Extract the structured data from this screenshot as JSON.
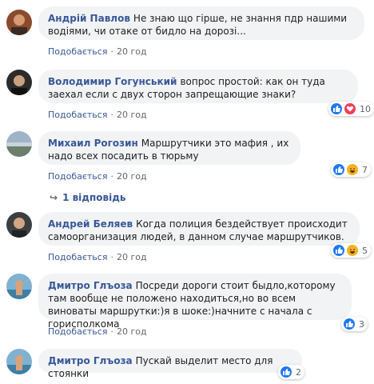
{
  "like_label": "Подобається",
  "comments": [
    {
      "author": "Андрій Павлов",
      "text": "Не знаю що гірше, не знання пдр нашими водіями, чи отаке от бидло на дорозі...",
      "time": "20 год",
      "reactions": [],
      "count": ""
    },
    {
      "author": "Володимир Гогунський",
      "text": "вопрос простой: как он туда заехал если с двух сторон запрещающие знаки?",
      "time": "20 год",
      "reactions": [
        "like",
        "love"
      ],
      "count": "10"
    },
    {
      "author": "Михаил Рогозин",
      "text": "Маршрутчики это мафия , их надо всех посадить в тюрьму",
      "time": "20 год",
      "reactions": [
        "like",
        "haha"
      ],
      "count": "7"
    },
    {
      "author": "Андрей Беляев",
      "text": "Когда полиция бездействует происходит самоорганизация людей, в данном случае маршрутчиков.",
      "time": "20 год",
      "reactions": [
        "like",
        "haha"
      ],
      "count": "5"
    },
    {
      "author": "Дмитро Глъоза",
      "text": "Посреди дороги стоит быдло,которому там вообще не положено находиться,но во всем виноваты маршрутки:)я в шоке:)начните с начала с горисполкома",
      "time": "20 год",
      "reactions": [
        "like"
      ],
      "count": "3"
    },
    {
      "author": "Дмитро Глъоза",
      "text": "Пускай выделит место для стоянки",
      "time": "",
      "reactions": [
        "like"
      ],
      "count": "2"
    }
  ],
  "reply_link": "1 відповідь",
  "colors": {
    "link": "#385898",
    "bubble": "#f2f3f5",
    "like": "#2078f4",
    "love": "#f33e58",
    "haha": "#f7b125"
  }
}
